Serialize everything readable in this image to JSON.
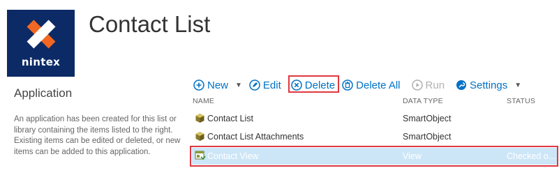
{
  "logo": {
    "text": "nintex"
  },
  "page": {
    "title": "Contact List"
  },
  "side": {
    "heading": "Application",
    "description": "An application has been created for this list or library containing the items listed to the right. Existing items can be edited or deleted, or new items can be added to this application."
  },
  "toolbar": {
    "new": "New",
    "edit": "Edit",
    "delete": "Delete",
    "delete_all": "Delete All",
    "run": "Run",
    "settings": "Settings"
  },
  "columns": {
    "name": "NAME",
    "data_type": "DATA TYPE",
    "status": "STATUS"
  },
  "rows": [
    {
      "name": "Contact List",
      "data_type": "SmartObject",
      "status": ""
    },
    {
      "name": "Contact List Attachments",
      "data_type": "SmartObject",
      "status": ""
    },
    {
      "name": "Contact View",
      "data_type": "View",
      "status": "Checked o..."
    }
  ],
  "colors": {
    "accent": "#0072c6",
    "logo_bg": "#0c2a66",
    "highlight": "#e0383f",
    "selected_row": "#cde6f7"
  }
}
